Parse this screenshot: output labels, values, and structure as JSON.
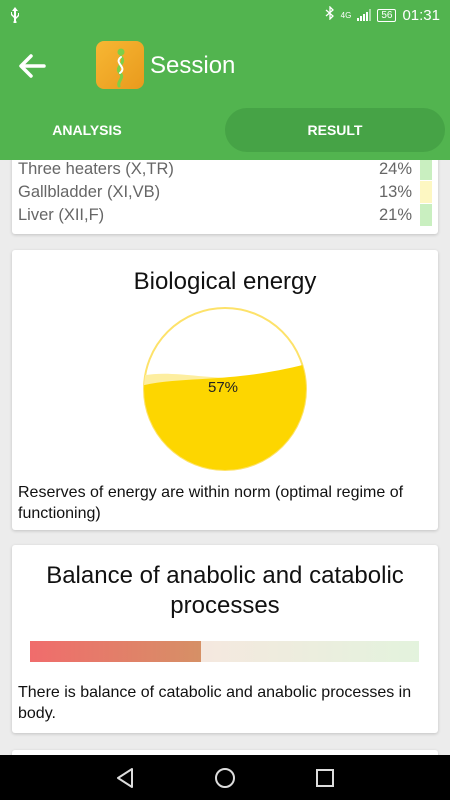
{
  "status_bar": {
    "time": "01:31",
    "battery": "56",
    "network": "4G"
  },
  "app_bar": {
    "title": "Session"
  },
  "tabs": [
    {
      "label": "ANALYSIS",
      "selected": false
    },
    {
      "label": "RESULT",
      "selected": true
    }
  ],
  "meridians": [
    {
      "name": "Three heaters (X,TR)",
      "percent": "24%",
      "color": "#c9efc0"
    },
    {
      "name": "Gallbladder (XI,VB)",
      "percent": "13%",
      "color": "#fdf7c2"
    },
    {
      "name": "Liver (XII,F)",
      "percent": "21%",
      "color": "#c9efc0"
    }
  ],
  "energy": {
    "title": "Biological energy",
    "value_label": "57%",
    "fill_fraction": 0.57,
    "fill_color": "#fdd600",
    "description": "Reserves of energy are within norm (optimal regime of functioning)"
  },
  "balance": {
    "title": "Balance of anabolic and catabolic processes",
    "left_fraction": 0.44,
    "description": "There is balance of catabolic and anabolic processes in body."
  },
  "colors": {
    "primary": "#52b44f",
    "tab_selected": "#46a346"
  }
}
